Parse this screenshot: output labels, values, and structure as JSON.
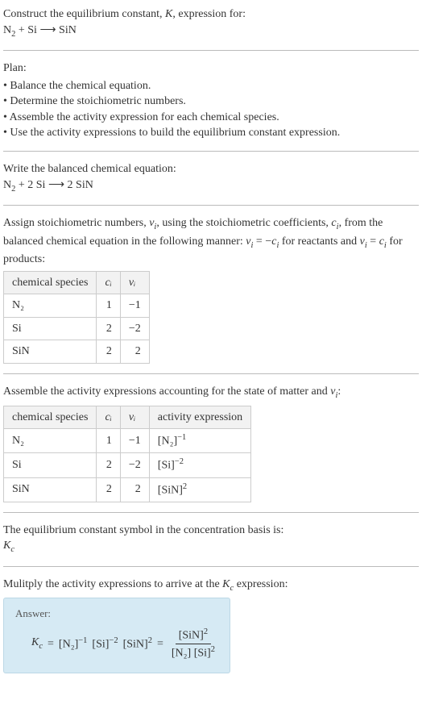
{
  "intro": {
    "line1_pre": "Construct the equilibrium constant, ",
    "line1_K": "K",
    "line1_post": ", expression for:",
    "eq_lhs": "N",
    "eq_lhs_sub": "2",
    "eq_plus": " + Si ",
    "eq_arrow": "⟶",
    "eq_rhs": " SiN"
  },
  "plan": {
    "heading": "Plan:",
    "items": [
      "Balance the chemical equation.",
      "Determine the stoichiometric numbers.",
      "Assemble the activity expression for each chemical species.",
      "Use the activity expressions to build the equilibrium constant expression."
    ]
  },
  "balanced": {
    "heading": "Write the balanced chemical equation:",
    "lhs": "N",
    "lhs_sub": "2",
    "plus": " + 2 Si ",
    "arrow": "⟶",
    "rhs": " 2 SiN"
  },
  "stoich": {
    "text_a": "Assign stoichiometric numbers, ",
    "nu": "ν",
    "nu_sub": "i",
    "text_b": ", using the stoichiometric coefficients, ",
    "c": "c",
    "c_sub": "i",
    "text_c": ", from the balanced chemical equation in the following manner: ",
    "rel1_lhs": "ν",
    "rel1_lhs_sub": "i",
    "rel1_eq": " = −",
    "rel1_rhs": "c",
    "rel1_rhs_sub": "i",
    "text_d": " for reactants and ",
    "rel2_lhs": "ν",
    "rel2_lhs_sub": "i",
    "rel2_eq": " = ",
    "rel2_rhs": "c",
    "rel2_rhs_sub": "i",
    "text_e": " for products:",
    "table": {
      "headers": [
        "chemical species",
        "cᵢ",
        "νᵢ"
      ],
      "rows": [
        {
          "species": "N₂",
          "c": "1",
          "nu": "−1"
        },
        {
          "species": "Si",
          "c": "2",
          "nu": "−2"
        },
        {
          "species": "SiN",
          "c": "2",
          "nu": "2"
        }
      ]
    }
  },
  "activity": {
    "text_a": "Assemble the activity expressions accounting for the state of matter and ",
    "nu": "ν",
    "nu_sub": "i",
    "text_b": ":",
    "table": {
      "headers": [
        "chemical species",
        "cᵢ",
        "νᵢ",
        "activity expression"
      ],
      "rows": [
        {
          "species": "N₂",
          "c": "1",
          "nu": "−1",
          "expr_base": "[N₂]",
          "expr_sup": "−1"
        },
        {
          "species": "Si",
          "c": "2",
          "nu": "−2",
          "expr_base": "[Si]",
          "expr_sup": "−2"
        },
        {
          "species": "SiN",
          "c": "2",
          "nu": "2",
          "expr_base": "[SiN]",
          "expr_sup": "2"
        }
      ]
    }
  },
  "kc_symbol": {
    "text": "The equilibrium constant symbol in the concentration basis is:",
    "sym": "K",
    "sym_sub": "c"
  },
  "multiply": {
    "text_a": "Mulitply the activity expressions to arrive at the ",
    "K": "K",
    "K_sub": "c",
    "text_b": " expression:"
  },
  "answer": {
    "label": "Answer:",
    "Kc": "K",
    "Kc_sub": "c",
    "eq": " = ",
    "t1_base": "[N₂]",
    "t1_sup": "−1",
    "t2_base": "[Si]",
    "t2_sup": "−2",
    "t3_base": "[SiN]",
    "t3_sup": "2",
    "eq2": " = ",
    "frac_num_base": "[SiN]",
    "frac_num_sup": "2",
    "frac_den_a": "[N₂]",
    "frac_den_b_base": "[Si]",
    "frac_den_b_sup": "2"
  },
  "chart_data": null
}
